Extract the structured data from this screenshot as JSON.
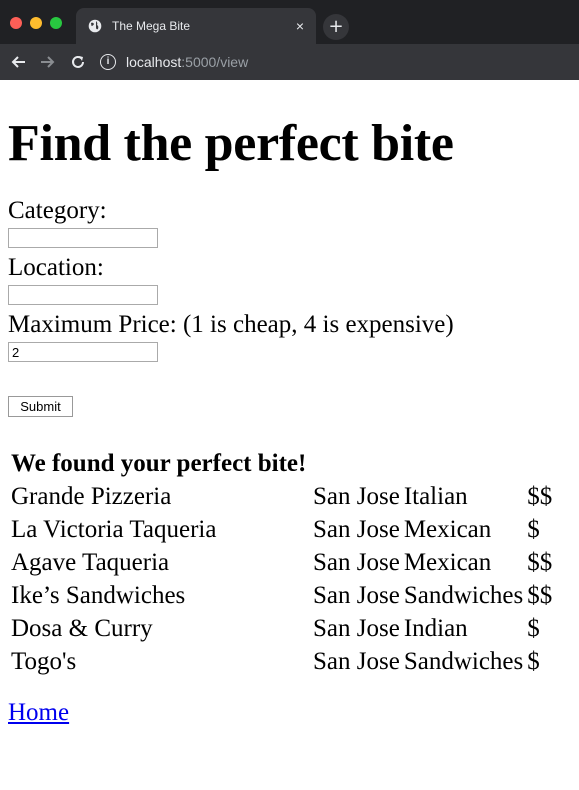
{
  "browser": {
    "tab_title": "The Mega Bite",
    "tab_close": "×",
    "new_tab": "+",
    "url_host": "localhost",
    "url_rest": ":5000/view",
    "info_symbol": "i"
  },
  "page": {
    "heading": "Find the perfect bite",
    "category_label": "Category:",
    "category_value": "",
    "location_label": "Location:",
    "location_value": "",
    "price_label": "Maximum Price: (1 is cheap, 4 is expensive)",
    "price_value": "2",
    "submit_label": "Submit",
    "results_heading": "We found your perfect bite!",
    "results": [
      {
        "name": "Grande Pizzeria",
        "city": "San Jose",
        "category": "Italian",
        "price": "$$"
      },
      {
        "name": "La Victoria Taqueria",
        "city": "San Jose",
        "category": "Mexican",
        "price": "$"
      },
      {
        "name": "Agave Taqueria",
        "city": "San Jose",
        "category": "Mexican",
        "price": "$$"
      },
      {
        "name": "Ike’s Sandwiches",
        "city": "San Jose",
        "category": "Sandwiches",
        "price": "$$"
      },
      {
        "name": "Dosa & Curry",
        "city": "San Jose",
        "category": "Indian",
        "price": "$"
      },
      {
        "name": "Togo's",
        "city": "San Jose",
        "category": "Sandwiches",
        "price": "$"
      }
    ],
    "home_link": "Home"
  },
  "icons": {
    "favicon": "globe-icon",
    "back": "back-arrow-icon",
    "forward": "forward-arrow-icon",
    "reload": "reload-icon",
    "info": "info-icon"
  }
}
